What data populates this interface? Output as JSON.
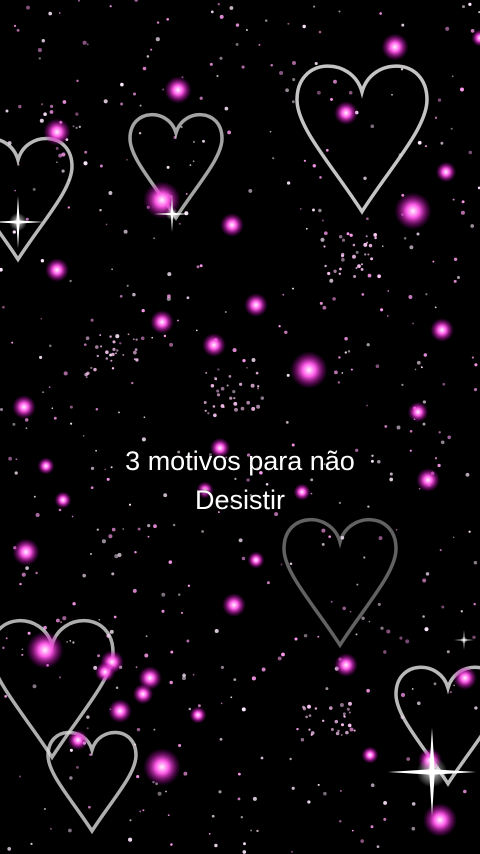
{
  "caption": {
    "line1": "3 motivos para não",
    "line2": "Desistir"
  },
  "colors": {
    "background": "#000000",
    "glow_dot": "#ff4fe6",
    "glow_core": "#ffe6ff",
    "heart_outline": "#d9d9d9",
    "caption_text": "#ffffff"
  },
  "decorations": {
    "hearts": "heart-outline-icon",
    "sparkles": "sparkle-star-icon",
    "dots": "glowing-dot"
  }
}
